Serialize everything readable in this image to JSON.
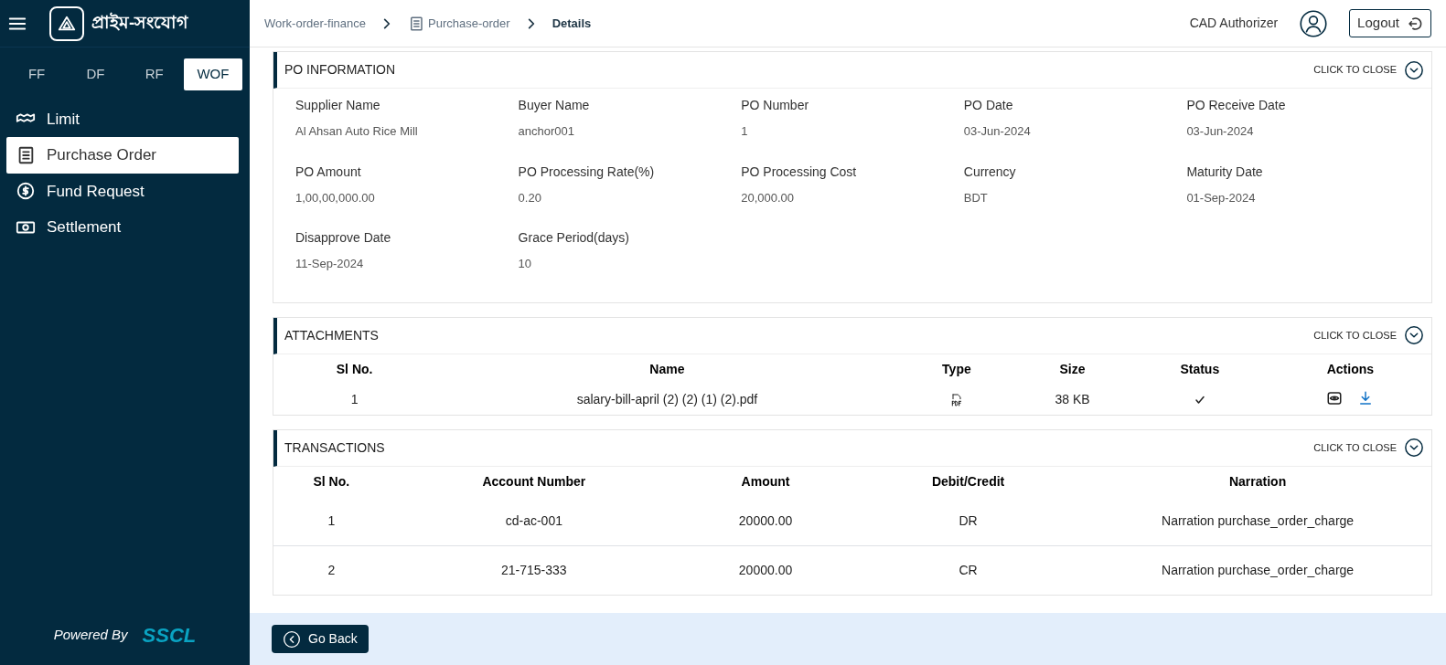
{
  "brand": {
    "title": "প্রাইম-সংযোগ"
  },
  "program_tabs": [
    {
      "label": "FF",
      "selected": false
    },
    {
      "label": "DF",
      "selected": false
    },
    {
      "label": "RF",
      "selected": false
    },
    {
      "label": "WOF",
      "selected": true
    }
  ],
  "sidebar": {
    "items": [
      {
        "label": "Limit",
        "selected": false
      },
      {
        "label": "Purchase Order",
        "selected": true
      },
      {
        "label": "Fund Request",
        "selected": false
      },
      {
        "label": "Settlement",
        "selected": false
      }
    ],
    "footer": {
      "prefix": "Powered By",
      "brand": "SSCL"
    }
  },
  "breadcrumb": [
    {
      "label": "Work-order-finance",
      "current": false
    },
    {
      "label": "Purchase-order",
      "current": false
    },
    {
      "label": "Details",
      "current": true
    }
  ],
  "header": {
    "user": "CAD Authorizer",
    "logout": "Logout"
  },
  "po_information": {
    "title": "PO INFORMATION",
    "toggle": "CLICK TO CLOSE",
    "expanded": true,
    "fields": [
      {
        "label": "Supplier Name",
        "value": "Al Ahsan Auto Rice Mill"
      },
      {
        "label": "Buyer Name",
        "value": "anchor001"
      },
      {
        "label": "PO Number",
        "value": "1"
      },
      {
        "label": "PO Date",
        "value": "03-Jun-2024"
      },
      {
        "label": "PO Receive Date",
        "value": "03-Jun-2024"
      },
      {
        "label": "PO Amount",
        "value": "1,00,00,000.00"
      },
      {
        "label": "PO Processing Rate(%)",
        "value": "0.20"
      },
      {
        "label": "PO Processing Cost",
        "value": "20,000.00"
      },
      {
        "label": "Currency",
        "value": "BDT"
      },
      {
        "label": "Maturity Date",
        "value": "01-Sep-2024"
      },
      {
        "label": "Disapprove Date",
        "value": "11-Sep-2024"
      },
      {
        "label": "Grace Period(days)",
        "value": "10"
      }
    ]
  },
  "attachments": {
    "title": "ATTACHMENTS",
    "toggle": "CLICK TO CLOSE",
    "expanded": true,
    "columns": [
      "Sl No.",
      "Name",
      "Type",
      "Size",
      "Status",
      "Actions"
    ],
    "rows": [
      {
        "sl": "1",
        "name": "salary-bill-april (2) (2) (1) (2).pdf",
        "size": "38 KB",
        "verified": true
      }
    ]
  },
  "transactions": {
    "title": "TRANSACTIONS",
    "toggle": "CLICK TO CLOSE",
    "expanded": true,
    "columns": [
      "Sl No.",
      "Account Number",
      "Amount",
      "Debit/Credit",
      "Narration"
    ],
    "rows": [
      [
        "1",
        "cd-ac-001",
        "20000.00",
        "DR",
        "Narration purchase_order_charge"
      ],
      [
        "2",
        "21-715-333",
        "20000.00",
        "CR",
        "Narration purchase_order_charge"
      ]
    ]
  },
  "go_back": "Go Back"
}
